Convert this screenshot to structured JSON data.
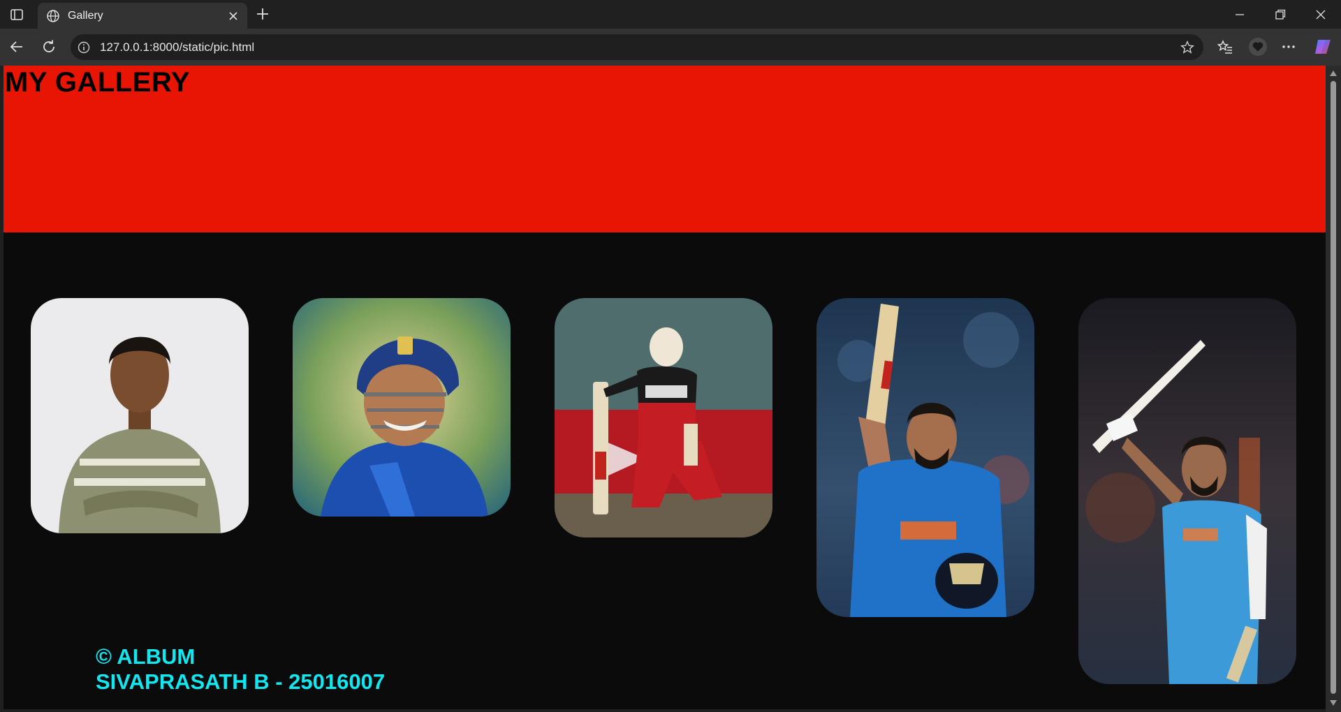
{
  "browser": {
    "tab_title": "Gallery",
    "url": "127.0.0.1:8000/static/pic.html"
  },
  "page": {
    "title": "MY GALLERY",
    "footer_line1": "© ALBUM",
    "footer_line2": "SIVAPRASATH B - 25016007"
  },
  "colors": {
    "header_bg": "#e81505",
    "page_bg": "#0b0b0c",
    "footer_text": "#12e6ef",
    "browser_chrome": "#333333"
  },
  "icons": [
    "sidebar-icon",
    "globe-icon",
    "close-icon",
    "plus-icon",
    "minimize-icon",
    "restore-icon",
    "back-icon",
    "refresh-icon",
    "info-icon",
    "star-icon",
    "favorites-icon",
    "heart-icon",
    "more-icon",
    "copilot-icon"
  ]
}
